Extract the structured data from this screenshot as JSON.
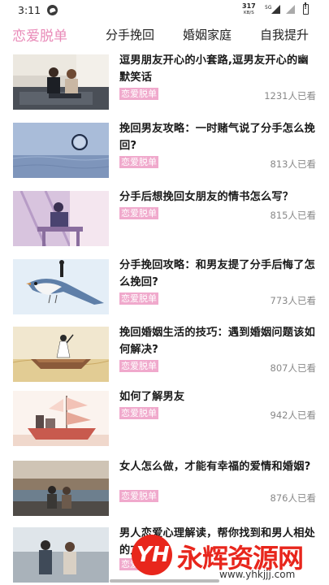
{
  "status_bar": {
    "time": "3:11",
    "speed": "317",
    "speed_unit": "KB/S",
    "network": "5G"
  },
  "tabs": [
    {
      "label": "恋爱脱单",
      "active": true
    },
    {
      "label": "分手挽回",
      "active": false
    },
    {
      "label": "婚姻家庭",
      "active": false
    },
    {
      "label": "自我提升",
      "active": false
    }
  ],
  "colors": {
    "accent": "#e98ab8",
    "tag_bg": "#f0a9cc",
    "watermark": "#e8261c"
  },
  "articles": [
    {
      "title": "逗男朋友开心的小套路,逗男友开心的幽默笑话",
      "tag": "恋爱脱单",
      "views": "1231人已看",
      "thumb": "couple-on-sofa"
    },
    {
      "title": "挽回男友攻略：一时赌气说了分手怎么挽回?",
      "tag": "恋爱脱单",
      "views": "813人已看",
      "thumb": "moon-over-sea"
    },
    {
      "title": "分手后想挽回女朋友的情书怎么写？",
      "tag": "恋爱脱单",
      "views": "815人已看",
      "thumb": "woman-at-window"
    },
    {
      "title": "分手挽回攻略：和男友提了分手后悔了怎么挽回?",
      "tag": "恋爱脱单",
      "views": "773人已看",
      "thumb": "bird-with-girl"
    },
    {
      "title": "挽回婚姻生活的技巧：遇到婚姻问题该如何解决?",
      "tag": "恋爱脱单",
      "views": "807人已看",
      "thumb": "girl-in-boat"
    },
    {
      "title": "如何了解男友",
      "tag": "恋爱脱单",
      "views": "942人已看",
      "thumb": "sailing-ship"
    },
    {
      "title": "女人怎么做，才能有幸福的爱情和婚姻?",
      "tag": "恋爱脱单",
      "views": "876人已看",
      "thumb": "couple-by-river"
    },
    {
      "title": "男人恋爱心理解读，帮你找到和男人相处的方式",
      "tag": "恋爱脱单",
      "views": "",
      "thumb": "couple-walking"
    }
  ],
  "watermark": {
    "logo": "YH",
    "text": "永辉资源网",
    "url": "www.yhkjjj.com"
  }
}
